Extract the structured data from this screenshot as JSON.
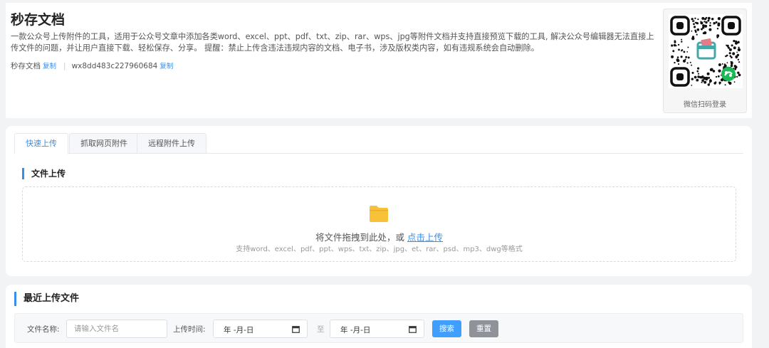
{
  "header": {
    "title": "秒存文档",
    "description": "一款公众号上传附件的工具，适用于公众号文章中添加各类word、excel、ppt、pdf、txt、zip、rar、wps、jpg等附件文档并支持直接预览下载的工具, 解决公众号编辑器无法直接上传文件的问题，并让用户直接下载、轻松保存、分享。 提醒：禁止上传含违法违规内容的文档、电子书，涉及版权类内容，如有违规系统会自动删除。",
    "account_name": "秒存文档",
    "account_copy": "复制",
    "app_id": "wx8dd483c227960684",
    "app_id_copy": "复制"
  },
  "qr": {
    "caption": "微信扫码登录"
  },
  "tabs": [
    {
      "label": "快速上传",
      "active": true
    },
    {
      "label": "抓取网页附件",
      "active": false
    },
    {
      "label": "远程附件上传",
      "active": false
    }
  ],
  "upload": {
    "section_title": "文件上传",
    "drop_text": "将文件拖拽到此处，或 ",
    "drop_link": "点击上传",
    "hint": "支持word、excel、pdf、ppt、wps、txt、zip、jpg、et、rar、psd、mp3、dwg等格式"
  },
  "recent": {
    "title": "最近上传文件",
    "name_label": "文件名称:",
    "name_placeholder": "请输入文件名",
    "time_label": "上传时间:",
    "date_from": "年 -月-日",
    "to_label": "至",
    "date_to": "年 -月-日",
    "search_label": "搜索",
    "reset_label": "重置"
  },
  "colors": {
    "accent": "#409eff",
    "folder": "#f7c23a",
    "qr_teal": "#44a8a8",
    "qr_green": "#19b955"
  }
}
